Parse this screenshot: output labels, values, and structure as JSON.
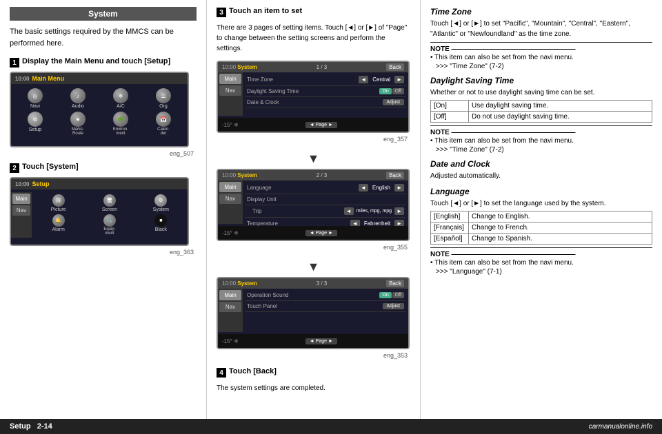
{
  "header": {
    "section_title": "System"
  },
  "left_col": {
    "intro": "The basic settings required by the MMCS can be performed here.",
    "step1": {
      "num": "1",
      "label": "Display the Main Menu and touch [Setup]",
      "eng": "eng_507",
      "screen_title": "Main Menu",
      "icons": [
        {
          "label": "Navi",
          "symbol": "◎"
        },
        {
          "label": "Audio",
          "symbol": "♪"
        },
        {
          "label": "A/C",
          "symbol": "❄"
        },
        {
          "label": "Org",
          "symbol": "📋"
        },
        {
          "label": "Setup",
          "symbol": "⚙"
        },
        {
          "label": "Marks·\nRoute",
          "symbol": "★"
        },
        {
          "label": "Environ·\nment",
          "symbol": "🌿"
        },
        {
          "label": "Calen·\nder",
          "symbol": "📅"
        }
      ]
    },
    "step2": {
      "num": "2",
      "label": "Touch [System]",
      "eng": "eng_363",
      "screen_title": "Setup",
      "icons": [
        {
          "label": "Main",
          "symbol": "◉"
        },
        {
          "label": "Nav",
          "symbol": "◎"
        },
        {
          "label": "Picture",
          "symbol": "🖼"
        },
        {
          "label": "Screen",
          "symbol": "🖥"
        },
        {
          "label": "System",
          "symbol": "⚙"
        },
        {
          "label": "Alarm",
          "symbol": "🔔"
        },
        {
          "label": "Equip·\nment",
          "symbol": "🔧"
        },
        {
          "label": "Black",
          "symbol": "■"
        }
      ]
    }
  },
  "mid_col": {
    "step3": {
      "num": "3",
      "label": "Touch an item to set",
      "intro": "There are 3 pages of setting items. Touch [◄] or [►] of \"Page\" to change between the setting screens and perform the settings.",
      "screens": [
        {
          "eng": "eng_357",
          "page": "1 / 3",
          "rows": [
            {
              "label": "Time Zone",
              "type": "arrows",
              "value": "Central"
            },
            {
              "label": "Daylight Saving Time",
              "type": "toggle",
              "on": true
            },
            {
              "label": "Date & Clock",
              "type": "adjust"
            }
          ]
        },
        {
          "eng": "eng_355",
          "page": "2 / 3",
          "rows": [
            {
              "label": "Language",
              "type": "arrows",
              "value": "English"
            },
            {
              "label": "Display Unit",
              "sub": "Trip",
              "value": "miles, mpg, mpg"
            },
            {
              "label": "Temperature",
              "type": "arrows",
              "value": "Fahrenheit"
            }
          ]
        },
        {
          "eng": "eng_353",
          "page": "3 / 3",
          "rows": [
            {
              "label": "Operation Sound",
              "type": "toggle",
              "on": true
            },
            {
              "label": "Touch Panel",
              "type": "adjust"
            }
          ]
        }
      ]
    },
    "step4": {
      "num": "4",
      "label": "Touch [Back]",
      "text": "The system settings are completed."
    }
  },
  "right_col": {
    "sections": [
      {
        "id": "time-zone",
        "title": "Time Zone",
        "text": "Touch [◄] or [►] to set \"Pacific\", \"Mountain\", \"Central\", \"Eastern\", \"Atlantic\" or \"Newfoundland\" as the time zone.",
        "note": {
          "bullet": "This item can also be set from the navi menu.",
          "ref": ">>> \"Time Zone\" (7-2)"
        }
      },
      {
        "id": "daylight-saving",
        "title": "Daylight Saving Time",
        "text": "Whether or not to use daylight saving time can be set.",
        "table": [
          {
            "key": "[On]",
            "val": "Use daylight saving time."
          },
          {
            "key": "[Off]",
            "val": "Do not use daylight saving time."
          }
        ],
        "note": {
          "bullet": "This item can also be set from the navi menu.",
          "ref": ">>> \"Time Zone\" (7-2)"
        }
      },
      {
        "id": "date-clock",
        "title": "Date and Clock",
        "text": "Adjusted automatically."
      },
      {
        "id": "language",
        "title": "Language",
        "text": "Touch [◄] or [►] to set the language used by the system.",
        "table": [
          {
            "key": "[English]",
            "val": "Change to English."
          },
          {
            "key": "[Français]",
            "val": "Change to French."
          },
          {
            "key": "[Español]",
            "val": "Change to Spanish."
          }
        ],
        "note": {
          "bullet": "This item can also be set from the navi menu.",
          "ref": ">>> \"Language\" (7-1)"
        }
      }
    ]
  },
  "footer": {
    "left": "Setup",
    "page": "2-14",
    "logo": "carmanualonline.info"
  }
}
